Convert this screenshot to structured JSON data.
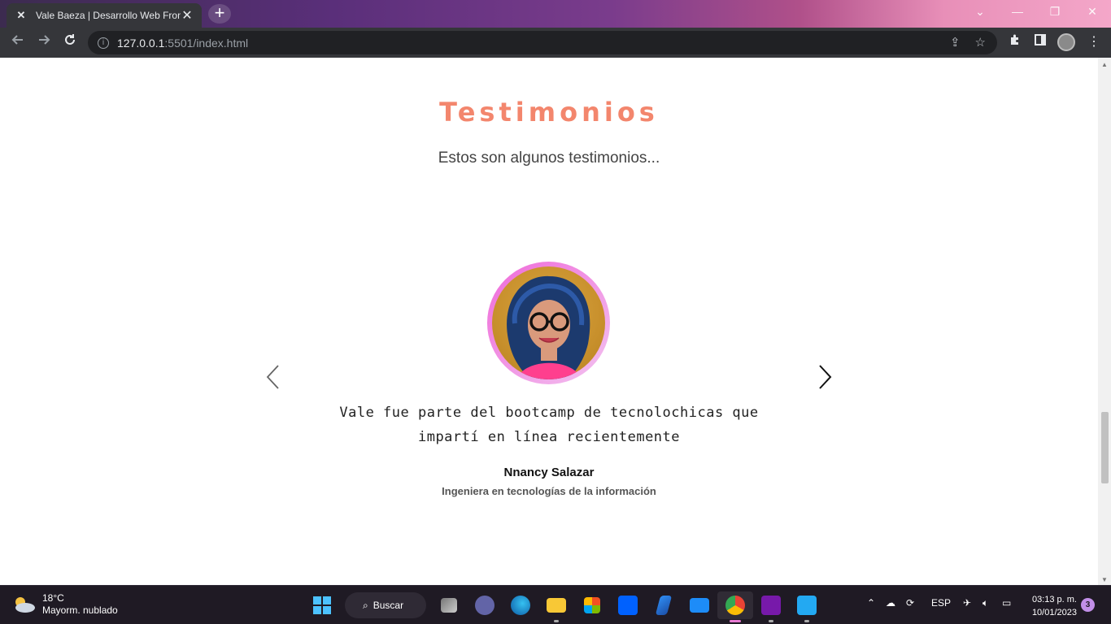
{
  "browser": {
    "tab_title": "Vale Baeza | Desarrollo Web Fron",
    "favicon_glyph": "✕",
    "tab_close": "✕",
    "new_tab": "+",
    "url_host": "127.0.0.1",
    "url_path": ":5501/index.html",
    "window_controls": {
      "dropdown": "⌄",
      "minimize": "—",
      "restore": "❐",
      "close": "✕"
    }
  },
  "section": {
    "title": "Testimonios",
    "subtitle": "Estos son algunos testimonios..."
  },
  "testimonial": {
    "quote_line1": "Vale fue parte del bootcamp de tecnolochicas que",
    "quote_line2": "impartí en línea recientemente",
    "author_name": "Nnancy Salazar",
    "author_role": "Ingeniera en tecnologías de la información"
  },
  "taskbar": {
    "weather_temp": "18°C",
    "weather_desc": "Mayorm. nublado",
    "search_label": "Buscar",
    "language": "ESP",
    "time": "03:13 p. m.",
    "date": "10/01/2023",
    "notification_count": "3",
    "tray_chevron": "⌃"
  },
  "colors": {
    "title_accent": "#f3866d",
    "avatar_ring": "#f06ad9"
  }
}
